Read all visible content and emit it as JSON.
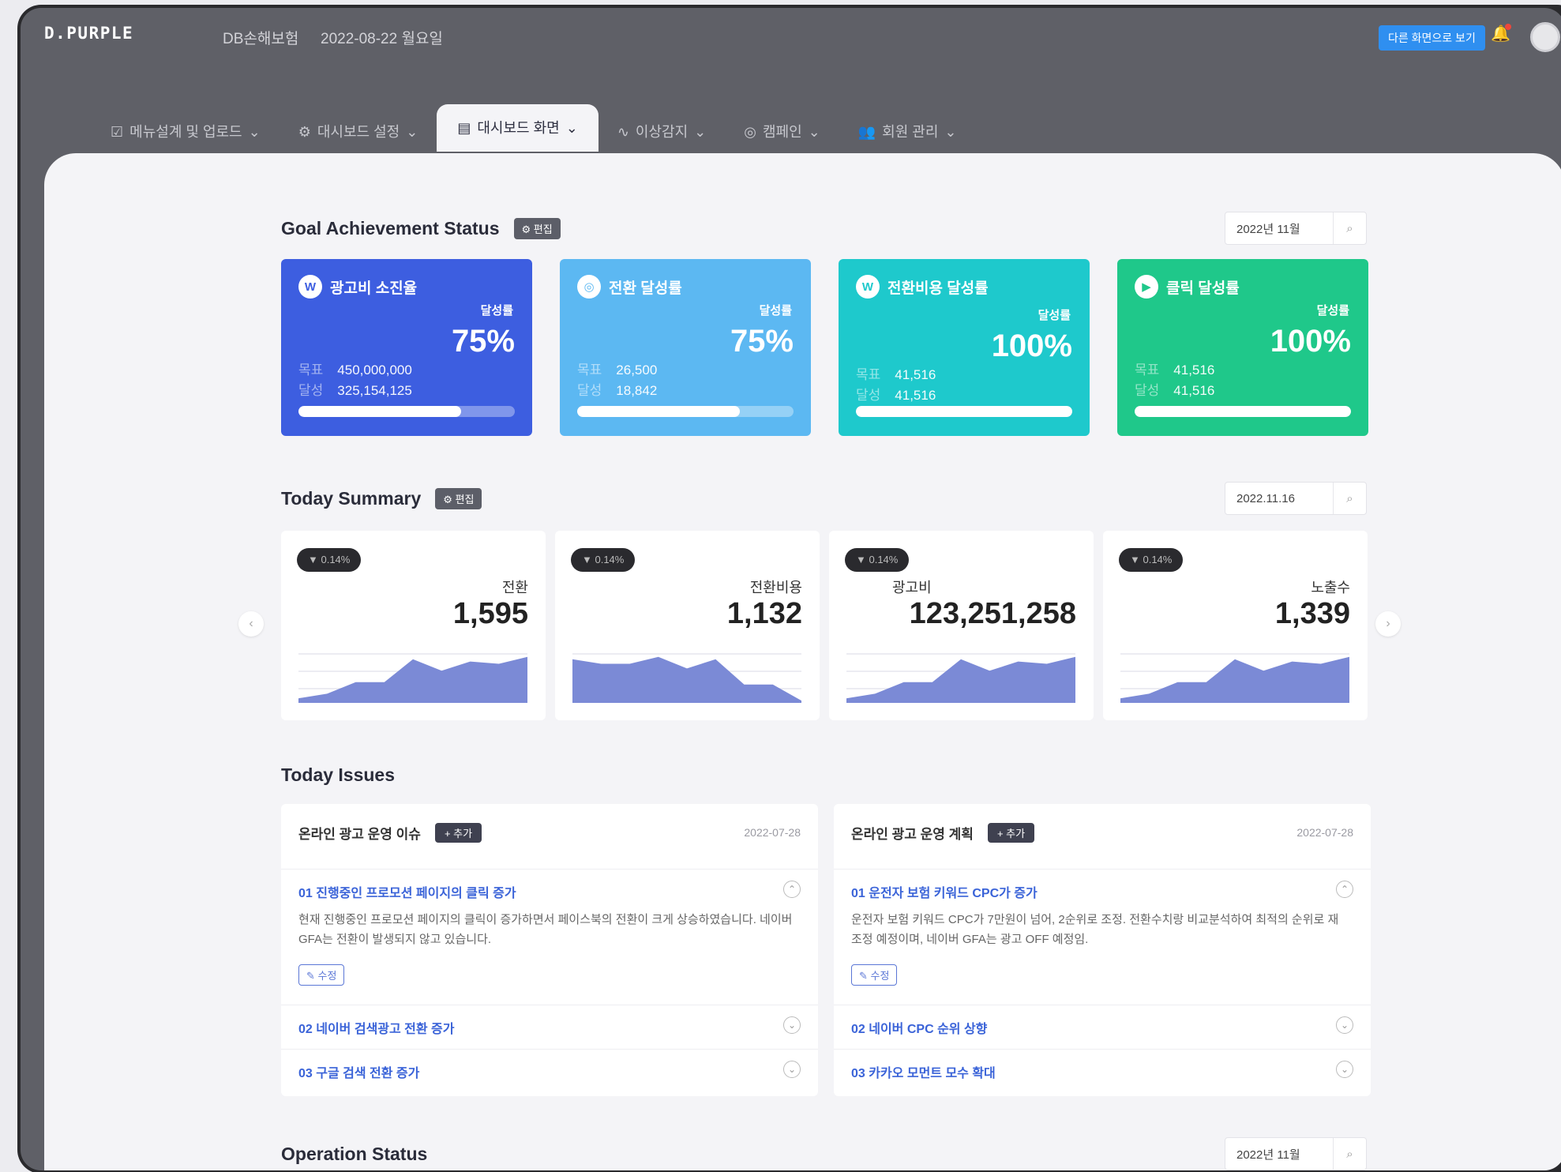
{
  "topbar": {
    "logo": "D.PURPLE",
    "company": "DB손해보험",
    "date": "2022-08-22 월요일",
    "dashboard_button": "다른 화면으로 보기"
  },
  "tabs": [
    {
      "label": "메뉴설계 및 업로드",
      "icon": "edit-icon"
    },
    {
      "label": "대시보드 설정",
      "icon": "gear-icon"
    },
    {
      "label": "대시보드 화면",
      "icon": "layout-icon",
      "active": true
    },
    {
      "label": "이상감지",
      "icon": "pulse-icon"
    },
    {
      "label": "캠페인",
      "icon": "target-icon"
    },
    {
      "label": "회원 관리",
      "icon": "users-icon"
    }
  ],
  "goal": {
    "title": "Goal Achievement Status",
    "edit_label": "⚙ 편집",
    "date": "2022년 11월",
    "cards": [
      {
        "title": "광고비 소진율",
        "icon": "W",
        "rate_label": "달성률",
        "rate": "75%",
        "k1": "목표",
        "v1": "450,000,000",
        "k2": "달성",
        "v2": "325,154,125",
        "progress": 0.75,
        "color": "#3d5ee0"
      },
      {
        "title": "전환 달성률",
        "icon": "◎",
        "rate_label": "달성률",
        "rate": "75%",
        "k1": "목표",
        "v1": "26,500",
        "k2": "달성",
        "v2": "18,842",
        "progress": 0.75,
        "color": "#5cb8f2"
      },
      {
        "title": "전환비용 달성률",
        "icon": "W",
        "rate_label": "달성률",
        "rate": "100%",
        "k1": "목표",
        "v1": "41,516",
        "k2": "달성",
        "v2": "41,516",
        "progress": 1.0,
        "color": "#1ec9cc"
      },
      {
        "title": "클릭 달성률",
        "icon": "▶",
        "rate_label": "달성률",
        "rate": "100%",
        "k1": "목표",
        "v1": "41,516",
        "k2": "달성",
        "v2": "41,516",
        "progress": 1.0,
        "color": "#1fc88a"
      }
    ]
  },
  "summary": {
    "title": "Today Summary",
    "edit_label": "⚙ 편집",
    "date": "2022.11.16",
    "cards": [
      {
        "change": "▼ 0.14%",
        "label": "전환",
        "value": "1,595",
        "trend": [
          2,
          4,
          9,
          9,
          19,
          14,
          18,
          17,
          20
        ]
      },
      {
        "change": "▼ 0.14%",
        "label": "전환비용",
        "value": "1,132",
        "trend": [
          19,
          17,
          17,
          20,
          15,
          19,
          8,
          8,
          1
        ]
      },
      {
        "change": "▼ 0.14%",
        "label": "광고비",
        "value": "123,251,258",
        "trend": [
          2,
          4,
          9,
          9,
          19,
          14,
          18,
          17,
          20
        ]
      },
      {
        "change": "▼ 0.14%",
        "label": "노출수",
        "value": "1,339",
        "trend": [
          2,
          4,
          9,
          9,
          19,
          14,
          18,
          17,
          20
        ]
      }
    ]
  },
  "issues": {
    "title": "Today Issues",
    "panels": [
      {
        "heading": "온라인 광고 운영 이슈",
        "add_label": "+ 추가",
        "date": "2022-07-28",
        "items": [
          {
            "title": "01  진행중인 프로모션 페이지의 클릭 증가",
            "body": "현재 진행중인 프로모션 페이지의 클릭이 증가하면서 페이스북의 전환이 크게 상승하였습니다. 네이버 GFA는 전환이 발생되지 않고 있습니다.",
            "edit_label": "✎ 수정"
          },
          {
            "title": "02  네이버 검색광고 전환 증가"
          },
          {
            "title": "03  구글 검색 전환 증가"
          }
        ]
      },
      {
        "heading": "온라인 광고 운영 계획",
        "add_label": "+ 추가",
        "date": "2022-07-28",
        "items": [
          {
            "title": "01  운전자 보험 키워드 CPC가 증가",
            "body": "운전자 보험 키워드 CPC가 7만원이 넘어, 2순위로 조정. 전환수치랑 비교분석하여 최적의 순위로 재조정 예정이며, 네이버 GFA는 광고 OFF 예정임.",
            "edit_label": "✎ 수정"
          },
          {
            "title": "02  네이버 CPC 순위 상향"
          },
          {
            "title": "03  카카오 모먼트 모수 확대"
          }
        ]
      }
    ]
  },
  "operation": {
    "title": "Operation Status",
    "date": "2022년 11월"
  }
}
